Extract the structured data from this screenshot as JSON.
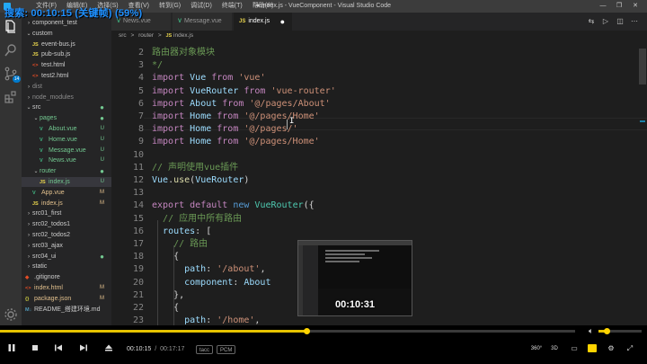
{
  "window": {
    "title": "● index.js - VueComponent - Visual Studio Code",
    "menu": [
      "文件(F)",
      "编辑(E)",
      "选择(S)",
      "查看(V)",
      "转到(G)",
      "调试(D)",
      "终端(T)",
      "帮助(H)"
    ],
    "controls": [
      "—",
      "❐",
      "✕"
    ]
  },
  "overlay": {
    "text": "搜索: 00:10:15 (关键帧) (59%)"
  },
  "activity_bar": {
    "items": [
      "explorer-icon",
      "search-icon",
      "source-control-icon",
      "debug-icon",
      "extensions-icon",
      "settings-gear-icon"
    ],
    "source_control_badge": "14"
  },
  "explorer": {
    "items": [
      {
        "label": "component_test",
        "kind": "folder",
        "expanded": false,
        "depth": 0,
        "status": "",
        "tone": "normal"
      },
      {
        "label": "custom",
        "kind": "folder",
        "expanded": true,
        "depth": 0,
        "status": "",
        "tone": "normal"
      },
      {
        "label": "event-bus.js",
        "kind": "js",
        "depth": 1,
        "status": "",
        "tone": "normal"
      },
      {
        "label": "pub-sub.js",
        "kind": "js",
        "depth": 1,
        "status": "",
        "tone": "normal"
      },
      {
        "label": "test.html",
        "kind": "html",
        "depth": 1,
        "status": "",
        "tone": "normal"
      },
      {
        "label": "test2.html",
        "kind": "html",
        "depth": 1,
        "status": "",
        "tone": "normal"
      },
      {
        "label": "dist",
        "kind": "folder",
        "expanded": false,
        "depth": 0,
        "status": "",
        "tone": "ignored"
      },
      {
        "label": "node_modules",
        "kind": "folder",
        "expanded": false,
        "depth": 0,
        "status": "",
        "tone": "ignored"
      },
      {
        "label": "src",
        "kind": "folder",
        "expanded": true,
        "depth": 0,
        "status": "●",
        "tone": "normal"
      },
      {
        "label": "pages",
        "kind": "folder",
        "expanded": true,
        "depth": 1,
        "status": "●",
        "tone": "untracked"
      },
      {
        "label": "About.vue",
        "kind": "vue",
        "depth": 2,
        "status": "U",
        "tone": "untracked"
      },
      {
        "label": "Home.vue",
        "kind": "vue",
        "depth": 2,
        "status": "U",
        "tone": "untracked"
      },
      {
        "label": "Message.vue",
        "kind": "vue",
        "depth": 2,
        "status": "U",
        "tone": "untracked"
      },
      {
        "label": "News.vue",
        "kind": "vue",
        "depth": 2,
        "status": "U",
        "tone": "untracked"
      },
      {
        "label": "router",
        "kind": "folder",
        "expanded": true,
        "depth": 1,
        "status": "●",
        "tone": "untracked"
      },
      {
        "label": "index.js",
        "kind": "js",
        "depth": 2,
        "status": "U",
        "tone": "untracked",
        "selected": true
      },
      {
        "label": "App.vue",
        "kind": "vue",
        "depth": 1,
        "status": "M",
        "tone": "modified"
      },
      {
        "label": "index.js",
        "kind": "js",
        "depth": 1,
        "status": "M",
        "tone": "modified"
      },
      {
        "label": "src01_first",
        "kind": "folder",
        "expanded": false,
        "depth": 0,
        "status": "",
        "tone": "normal"
      },
      {
        "label": "src02_todos1",
        "kind": "folder",
        "expanded": false,
        "depth": 0,
        "status": "",
        "tone": "normal"
      },
      {
        "label": "src02_todos2",
        "kind": "folder",
        "expanded": false,
        "depth": 0,
        "status": "",
        "tone": "normal"
      },
      {
        "label": "src03_ajax",
        "kind": "folder",
        "expanded": false,
        "depth": 0,
        "status": "",
        "tone": "normal"
      },
      {
        "label": "src04_ui",
        "kind": "folder",
        "expanded": false,
        "depth": 0,
        "status": "●",
        "tone": "normal"
      },
      {
        "label": "static",
        "kind": "folder",
        "expanded": false,
        "depth": 0,
        "status": "",
        "tone": "normal"
      },
      {
        "label": ".gitignore",
        "kind": "git",
        "depth": 0,
        "status": "",
        "tone": "normal"
      },
      {
        "label": "index.html",
        "kind": "html",
        "depth": 0,
        "status": "M",
        "tone": "modified"
      },
      {
        "label": "package.json",
        "kind": "json",
        "depth": 0,
        "status": "M",
        "tone": "modified"
      },
      {
        "label": "README_搭建环境.md",
        "kind": "md",
        "depth": 0,
        "status": "",
        "tone": "normal"
      }
    ]
  },
  "tabs": [
    {
      "label": "News.vue",
      "kind": "vue",
      "active": false,
      "dirty": false
    },
    {
      "label": "Message.vue",
      "kind": "vue",
      "active": false,
      "dirty": false
    },
    {
      "label": "index.js",
      "kind": "js",
      "active": true,
      "dirty": true
    }
  ],
  "breadcrumb": [
    "src",
    "router",
    "index.js"
  ],
  "breadcrumb_sep": ">",
  "code": {
    "first_line_number": 2,
    "lines": [
      [
        [
          "路由器对象模块",
          "cm"
        ]
      ],
      [
        [
          "*/",
          "cm"
        ]
      ],
      [
        [
          "import ",
          "kw"
        ],
        [
          "Vue ",
          "var"
        ],
        [
          "from ",
          "kw"
        ],
        [
          "'vue'",
          "str"
        ]
      ],
      [
        [
          "import ",
          "kw"
        ],
        [
          "VueRouter ",
          "var"
        ],
        [
          "from ",
          "kw"
        ],
        [
          "'vue-router'",
          "str"
        ]
      ],
      [
        [
          "import ",
          "kw"
        ],
        [
          "About ",
          "var"
        ],
        [
          "from ",
          "kw"
        ],
        [
          "'@/pages/About'",
          "str"
        ]
      ],
      [
        [
          "import ",
          "kw"
        ],
        [
          "Home ",
          "var"
        ],
        [
          "from ",
          "kw"
        ],
        [
          "'@/pages/Home'",
          "str"
        ]
      ],
      [
        [
          "import ",
          "kw"
        ],
        [
          "Home ",
          "var"
        ],
        [
          "from ",
          "kw"
        ],
        [
          "'@/pages/'",
          "str"
        ]
      ],
      [
        [
          "import ",
          "kw"
        ],
        [
          "Home ",
          "var"
        ],
        [
          "from ",
          "kw"
        ],
        [
          "'@/pages/Home'",
          "str"
        ]
      ],
      [],
      [
        [
          "// 声明使用vue插件",
          "cm"
        ]
      ],
      [
        [
          "Vue",
          "var"
        ],
        [
          ".",
          "pl"
        ],
        [
          "use",
          "fn"
        ],
        [
          "(",
          "pl"
        ],
        [
          "VueRouter",
          "var"
        ],
        [
          ")",
          "pl"
        ]
      ],
      [],
      [
        [
          "export ",
          "kw"
        ],
        [
          "default ",
          "kw"
        ],
        [
          "new ",
          "kw2"
        ],
        [
          "VueRouter",
          "cls"
        ],
        [
          "({",
          "pl"
        ]
      ],
      [
        [
          "  ",
          "pl"
        ],
        [
          "// 应用中所有路由",
          "cm"
        ]
      ],
      [
        [
          "  ",
          "pl"
        ],
        [
          "routes",
          "var"
        ],
        [
          ": [",
          "pl"
        ]
      ],
      [
        [
          "    ",
          "pl"
        ],
        [
          "// 路由",
          "cm"
        ]
      ],
      [
        [
          "    {",
          "pl"
        ]
      ],
      [
        [
          "      ",
          "pl"
        ],
        [
          "path",
          "var"
        ],
        [
          ": ",
          "pl"
        ],
        [
          "'/about'",
          "str"
        ],
        [
          ",",
          "pl"
        ]
      ],
      [
        [
          "      ",
          "pl"
        ],
        [
          "component",
          "var"
        ],
        [
          ": ",
          "pl"
        ],
        [
          "About",
          "var"
        ]
      ],
      [
        [
          "    },",
          "pl"
        ]
      ],
      [
        [
          "    {",
          "pl"
        ]
      ],
      [
        [
          "      ",
          "pl"
        ],
        [
          "path",
          "var"
        ],
        [
          ": ",
          "pl"
        ],
        [
          "'/home'",
          "str"
        ],
        [
          ",",
          "pl"
        ]
      ]
    ]
  },
  "preview": {
    "time": "00:10:31"
  },
  "player": {
    "progress": 0.5333,
    "volume": 0.2,
    "current_time": "00:10:15",
    "separator": "/",
    "total_time": "00:17:17",
    "badges": [
      "tacc",
      "PCM"
    ],
    "right_controls": [
      "360°",
      "3D",
      "▭",
      "■",
      "⚙",
      "⤢"
    ],
    "accent": "#ffd400"
  }
}
